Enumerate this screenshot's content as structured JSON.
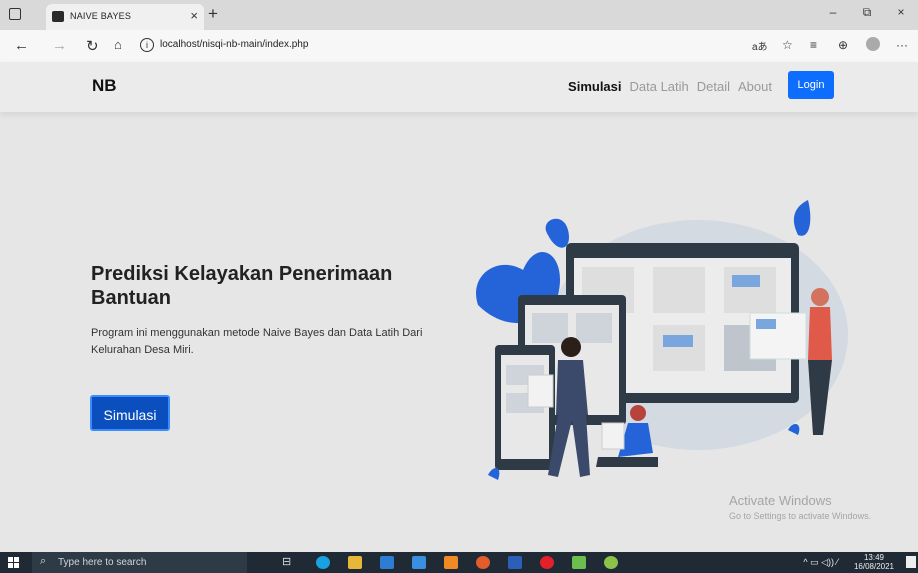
{
  "browser": {
    "tab_title": "NAIVE BAYES",
    "tab_close": "×",
    "new_tab": "+",
    "url": "localhost/nisqi-nb-main/index.php",
    "window_controls": [
      "–",
      "⧉",
      "×"
    ]
  },
  "navbar": {
    "brand": "NB",
    "links": [
      {
        "label": "Simulasi",
        "active": true
      },
      {
        "label": "Data Latih",
        "active": false
      },
      {
        "label": "Detail",
        "active": false
      },
      {
        "label": "About",
        "active": false
      }
    ],
    "login_label": "Login"
  },
  "hero": {
    "title": "Prediksi Kelayakan Penerimaan Bantuan",
    "description": "Program ini menggunakan metode Naive Bayes dan Data Latih Dari Kelurahan Desa Miri.",
    "button_label": "Simulasi"
  },
  "watermark": {
    "line1": "Activate Windows",
    "line2": "Go to Settings to activate Windows."
  },
  "taskbar": {
    "search_placeholder": "Type here to search",
    "time": "13:49",
    "date": "16/08/2021"
  },
  "colors": {
    "primary": "#0d6efd",
    "cta": "#0b4fbf",
    "page_bg": "#e6e6e6",
    "illustration_blue": "#2463d8"
  }
}
